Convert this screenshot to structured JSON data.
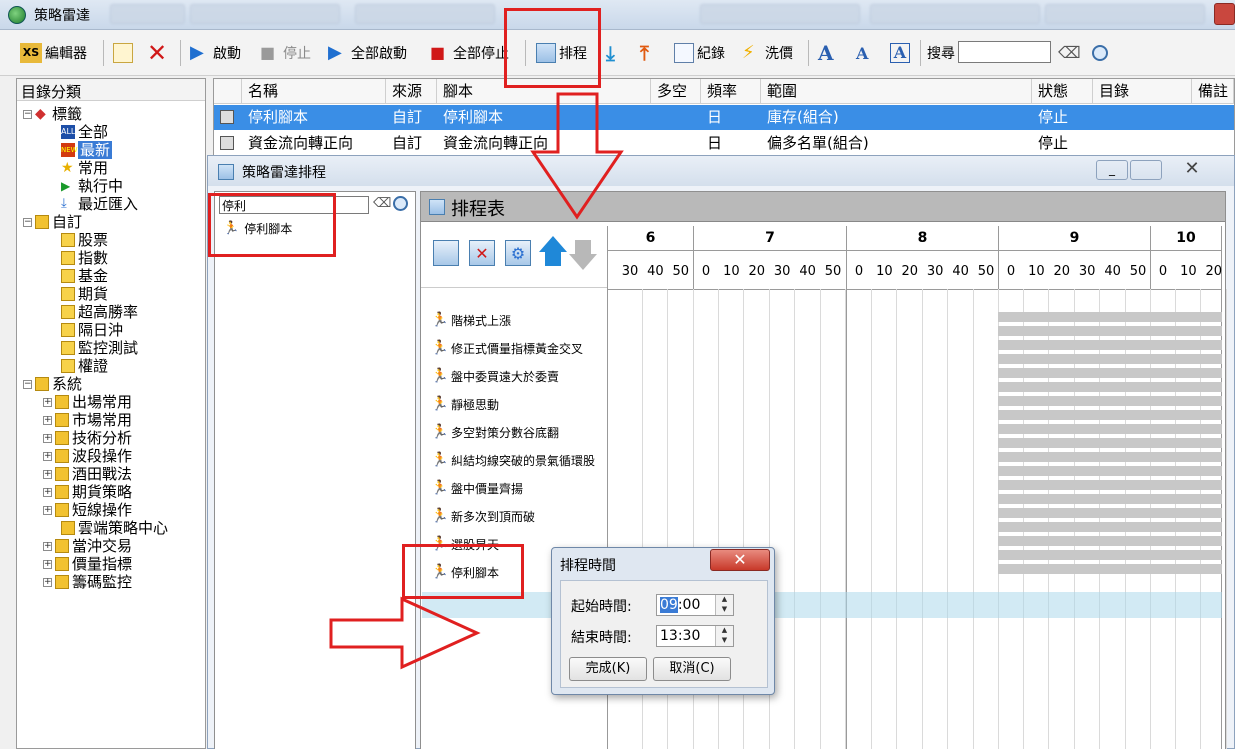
{
  "window": {
    "title": "策略雷達"
  },
  "toolbar": {
    "editor": "編輯器",
    "start": "啟動",
    "stop": "停止",
    "start_all": "全部啟動",
    "stop_all": "全部停止",
    "schedule": "排程",
    "log": "紀錄",
    "wash": "洗價",
    "search_label": "搜尋",
    "search_value": ""
  },
  "tree": {
    "header": "目錄分類",
    "tags_group": "標籤",
    "tags": [
      "全部",
      "最新",
      "常用",
      "執行中",
      "最近匯入"
    ],
    "custom_group": "自訂",
    "custom": [
      "股票",
      "指數",
      "基金",
      "期貨",
      "超高勝率",
      "隔日沖",
      "監控測試",
      "權證"
    ],
    "system_group": "系統",
    "system": [
      "出場常用",
      "市場常用",
      "技術分析",
      "波段操作",
      "酒田戰法",
      "期貨策略",
      "短線操作",
      "雲端策略中心",
      "當沖交易",
      "價量指標",
      "籌碼監控"
    ]
  },
  "grid": {
    "columns": [
      "名稱",
      "來源",
      "腳本",
      "多空",
      "頻率",
      "範圍",
      "狀態",
      "目錄",
      "備註"
    ],
    "rows": [
      {
        "name": "停利腳本",
        "source": "自訂",
        "script": "停利腳本",
        "dir": "",
        "freq": "日",
        "range": "庫存(組合)",
        "status": "停止"
      },
      {
        "name": "資金流向轉正向",
        "source": "自訂",
        "script": "資金流向轉正向",
        "dir": "",
        "freq": "日",
        "range": "偏多名單(組合)",
        "status": "停止"
      }
    ],
    "selected_row": 0
  },
  "scheduler": {
    "title": "策略雷達排程",
    "search_value": "停利",
    "result_item": "停利腳本",
    "panel_title": "排程表",
    "hours": [
      "6",
      "7",
      "8",
      "9",
      "10"
    ],
    "minutes_h6": [
      "30",
      "40",
      "50"
    ],
    "minutes": [
      "0",
      "10",
      "20",
      "30",
      "40",
      "50"
    ],
    "minutes_h10": [
      "0",
      "10",
      "20"
    ],
    "scripts": [
      "階梯式上漲",
      "修正式價量指標黃金交叉",
      "盤中委買遠大於委賣",
      "靜極思動",
      "多空對策分數谷底翻",
      "糾結均線突破的景氣循環股",
      "盤中價量齊揚",
      "新多次到頂而破",
      "選股昇天",
      "停利腳本"
    ]
  },
  "dialog": {
    "title": "排程時間",
    "start_label": "起始時間:",
    "start_hour": "09",
    "start_rest": ":00",
    "end_label": "結束時間:",
    "end_value": "13:30",
    "ok": "完成(K)",
    "cancel": "取消(C)"
  }
}
